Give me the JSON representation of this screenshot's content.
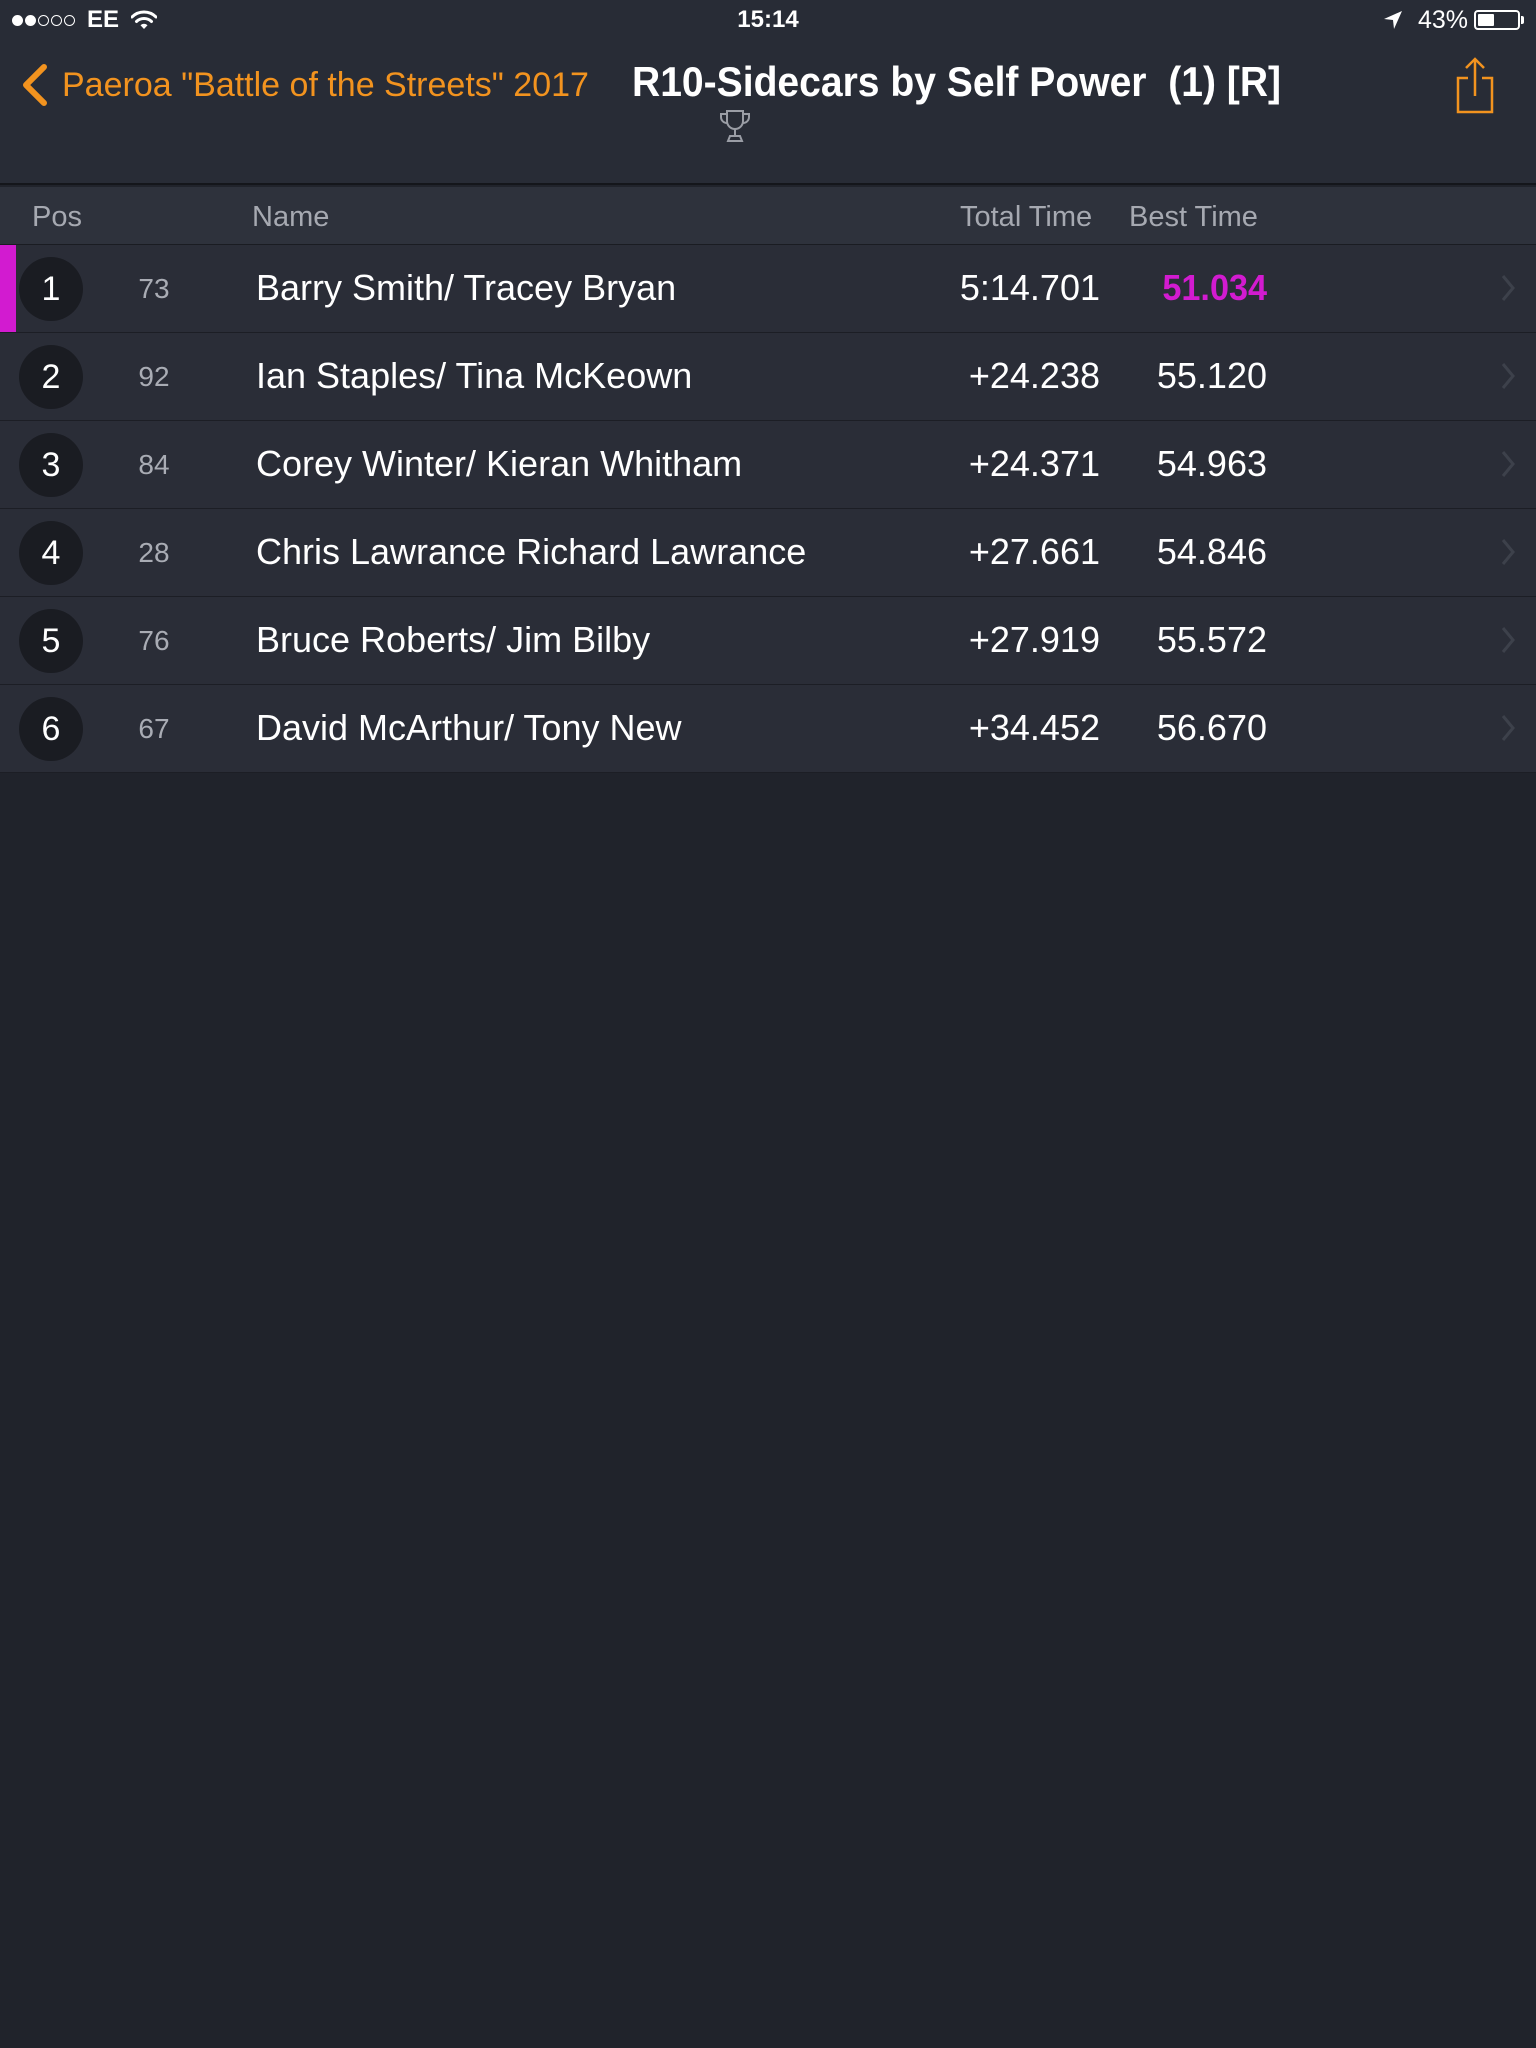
{
  "status_bar": {
    "carrier": "EE",
    "time": "15:14",
    "battery_percent": "43%",
    "battery_level": 0.43,
    "signal_bars_filled": 2,
    "signal_bars_total": 5
  },
  "nav": {
    "back_label": "Paeroa \"Battle of the Streets\" 2017",
    "title": "R10-Sidecars by Self Power  (1) [R]",
    "back_icon": "chevron-left-icon",
    "trophy_icon": "trophy-icon",
    "share_icon": "share-icon"
  },
  "colors": {
    "accent": "#f2931f",
    "fastest": "#d21bd0",
    "background": "#20232b",
    "row": "#2a2d37"
  },
  "table": {
    "columns": {
      "pos": "Pos",
      "name": "Name",
      "total_time": "Total Time",
      "best_time": "Best Time"
    },
    "rows": [
      {
        "pos": "1",
        "number": "73",
        "name": "Barry Smith/ Tracey Bryan",
        "total": "5:14.701",
        "best": "51.034"
      },
      {
        "pos": "2",
        "number": "92",
        "name": "Ian Staples/ Tina McKeown",
        "total": "+24.238",
        "best": "55.120"
      },
      {
        "pos": "3",
        "number": "84",
        "name": "Corey Winter/ Kieran Whitham",
        "total": "+24.371",
        "best": "54.963"
      },
      {
        "pos": "4",
        "number": "28",
        "name": "Chris Lawrance Richard Lawrance",
        "total": "+27.661",
        "best": "54.846"
      },
      {
        "pos": "5",
        "number": "76",
        "name": "Bruce Roberts/ Jim Bilby",
        "total": "+27.919",
        "best": "55.572"
      },
      {
        "pos": "6",
        "number": "67",
        "name": "David McArthur/ Tony New",
        "total": "+34.452",
        "best": "56.670"
      }
    ]
  }
}
